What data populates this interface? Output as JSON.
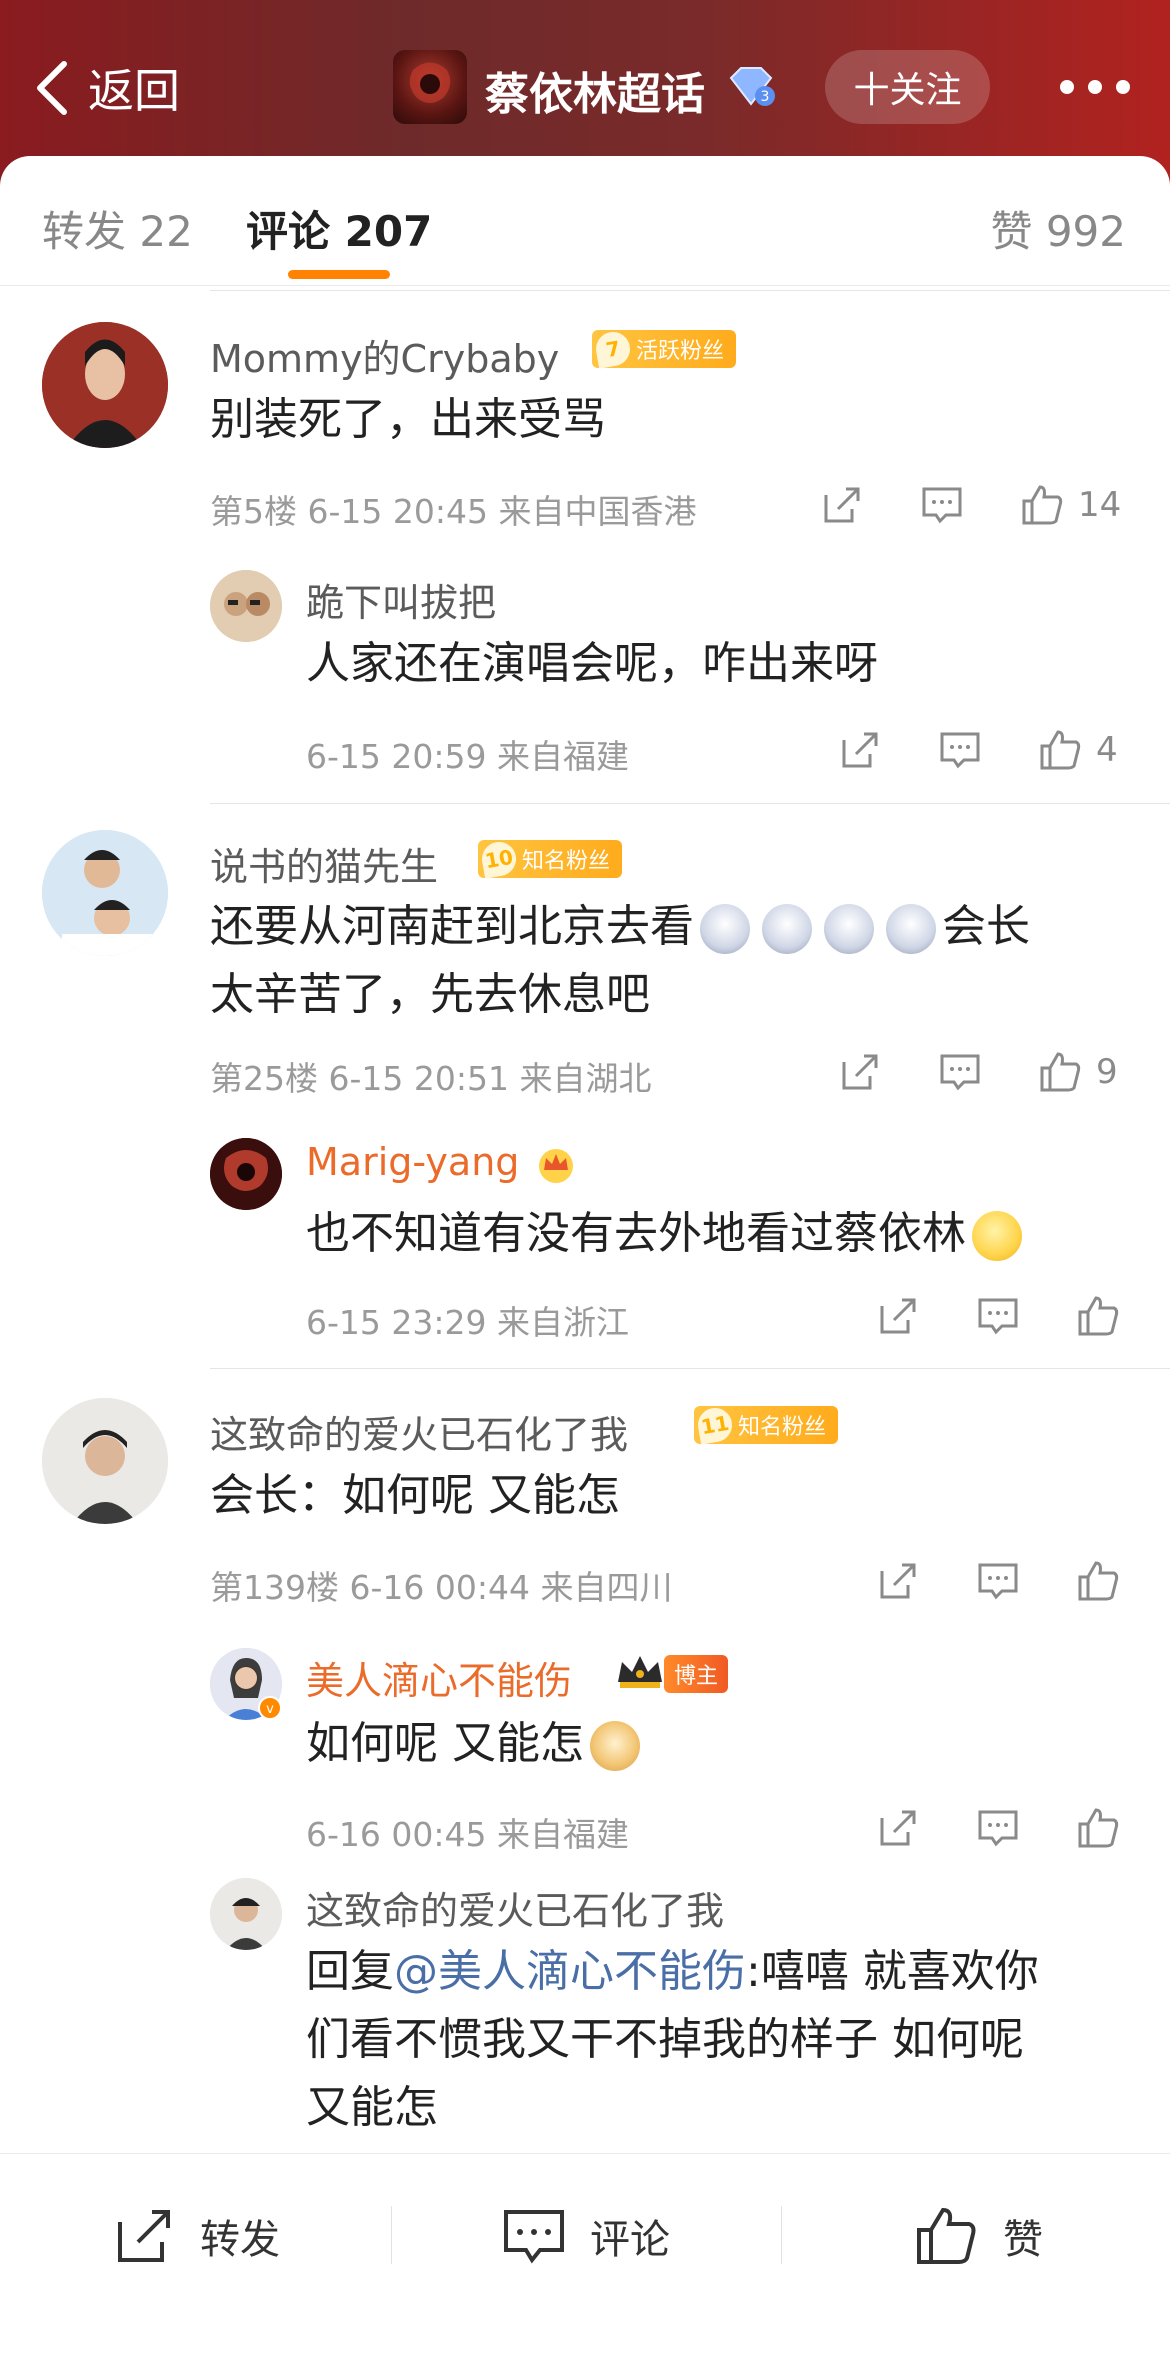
{
  "header": {
    "back_label": "返回",
    "topic_title": "蔡依林超话",
    "follow_label": "十关注",
    "colors": {
      "bar_left": "#8a1b1f",
      "bar_right": "#b1221f"
    }
  },
  "tabs": {
    "repost": "转发 22",
    "comment": "评论 207",
    "like": "赞 992",
    "accent": "#ff8200"
  },
  "comments": [
    {
      "name": "Mommy的Crybaby",
      "badge_level": "7",
      "badge_text": "活跃粉丝",
      "text": "别装死了，出来受骂",
      "meta": "第5楼 6-15 20:45 来自中国香港",
      "likes": "14",
      "reply": {
        "name": "跪下叫拔把",
        "text": "人家还在演唱会呢，咋出来呀",
        "meta": "6-15 20:59 来自福建",
        "likes": "4"
      }
    },
    {
      "name": "说书的猫先生",
      "badge_level": "10",
      "badge_text": "知名粉丝",
      "text_line1_a": "还要从河南赶到北京去看",
      "text_line1_b": "会长",
      "text_line2": "太辛苦了，先去休息吧",
      "meta": "第25楼 6-15 20:51 来自湖北",
      "likes": "9",
      "reply": {
        "name": "Marig-yang",
        "text": "也不知道有没有去外地看过蔡依林",
        "meta": "6-15 23:29 来自浙江"
      }
    },
    {
      "name": "这致命的爱火已石化了我",
      "badge_level": "11",
      "badge_text": "知名粉丝",
      "text": "会长：如何呢 又能怎",
      "meta": "第139楼 6-16 00:44 来自四川",
      "reply": {
        "name": "美人滴心不能伤",
        "owner_badge": "博主",
        "text": "如何呢 又能怎",
        "meta": "6-16 00:45 来自福建"
      },
      "reply2": {
        "name": "这致命的爱火已石化了我",
        "prefix": "回复",
        "mention": "@美人滴心不能伤",
        "line1_rest": ":嘻嘻 就喜欢你",
        "line2": "们看不惯我又干不掉我的样子 如何呢",
        "line3": "又能怎"
      }
    }
  ],
  "bottom_bar": {
    "repost": "转发",
    "comment": "评论",
    "like": "赞"
  }
}
